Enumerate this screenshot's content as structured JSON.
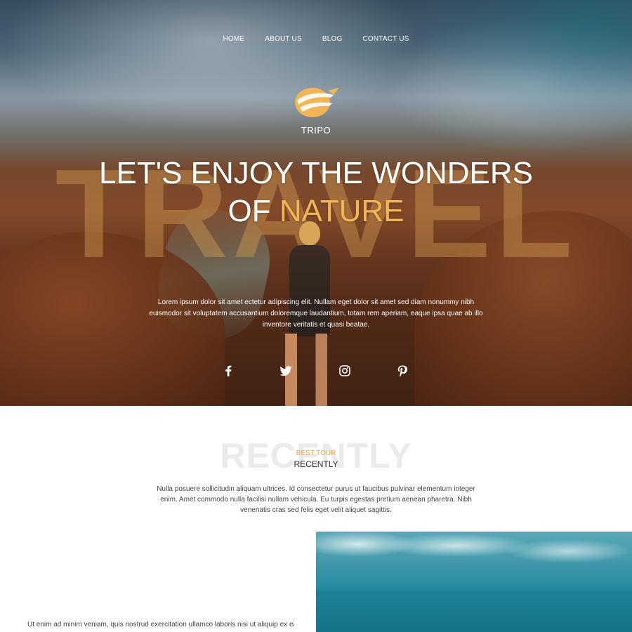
{
  "nav": {
    "items": [
      {
        "label": "HOME"
      },
      {
        "label": "ABOUT US"
      },
      {
        "label": "BLOG"
      },
      {
        "label": "CONTACT US"
      }
    ]
  },
  "brand": {
    "name": "TRIPO",
    "logo_icon": "globe-plane-logo-icon",
    "accent_color": "#f2b556"
  },
  "hero": {
    "background_word": "TRAVEL",
    "headline_line1": "LET'S ENJOY THE WONDERS",
    "headline_line2_prefix": "OF ",
    "headline_line2_accent": "NATURE",
    "text": "Lorem ipsum dolor sit amet ectetur adipiscing elit. Nullam eget dolor sit amet sed diam nonummy nibh euismodor sit voluptatem accusantium doloremque laudantium, totam rem aperiam, eaque ipsa quae ab illo inventore veritatis et quasi beatae.",
    "socials": [
      {
        "icon": "facebook-icon"
      },
      {
        "icon": "twitter-icon"
      },
      {
        "icon": "instagram-icon"
      },
      {
        "icon": "pinterest-icon"
      }
    ]
  },
  "section": {
    "background_word": "RECENTLY",
    "eyebrow": "BEST TOUR",
    "title": "RECENTLY",
    "description": "Nulla posuere sollicitudin aliquam ultrices. Id consectetur purus ut faucibus pulvinar elementum integer enim. Amet commodo nulla facilisi nullam vehicula. Eu turpis egestas pretium aenean pharetra. Nibh venenatis cras sed felis eget velit aliquet sagittis.",
    "tour_text": "Ut enim ad minim veniam, quis nostrud exercitation ullamco laboris nisi ut aliquip ex ea"
  }
}
